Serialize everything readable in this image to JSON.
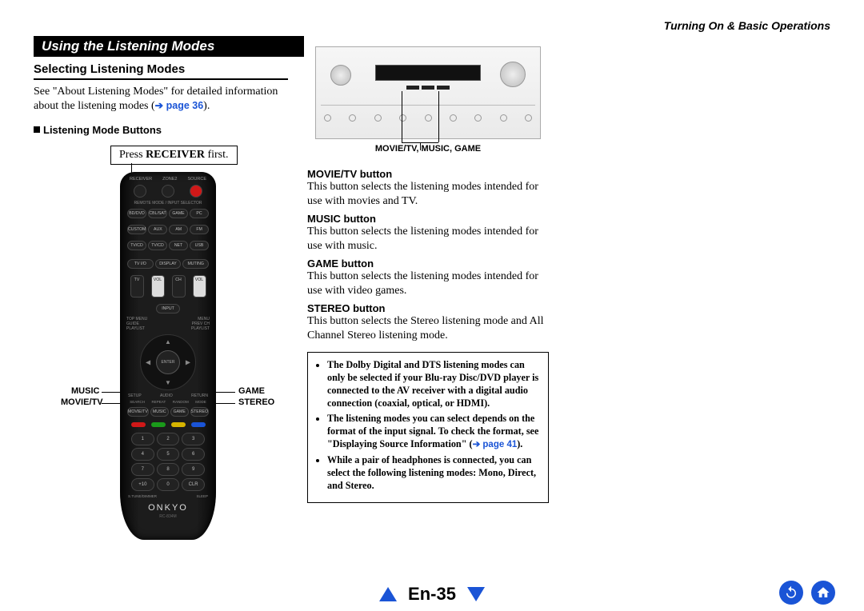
{
  "chapter_title": "Turning On & Basic Operations",
  "section_title": "Using the Listening Modes",
  "subheading": "Selecting Listening Modes",
  "intro_text_1": "See \"About Listening Modes\" for detailed information about the listening modes (",
  "intro_link_arrow": "➔ page 36",
  "intro_text_2": ").",
  "listening_mode_buttons_label": "Listening Mode Buttons",
  "press_receiver_prefix": "Press ",
  "press_receiver_bold": "RECEIVER",
  "press_receiver_suffix": " first.",
  "remote": {
    "brand": "ONKYO",
    "model": "RC-834M",
    "top_labels": [
      "RECEIVER",
      "ZONE2",
      "SOURCE"
    ],
    "selector_label": "REMOTE MODE / INPUT SELECTOR",
    "selector_rows": [
      [
        "BD/DVD",
        "CBL/SAT",
        "GAME",
        "PC"
      ],
      [
        "CUSTOM",
        "AUX",
        "AM",
        "FM"
      ],
      [
        "TV/CD",
        "TV/CD",
        "NET",
        "USB"
      ]
    ],
    "mid_row": [
      "TV I/O",
      "DISPLAY",
      "MUTING"
    ],
    "nav_row": [
      "TV",
      "VOL",
      "CH",
      "VOL"
    ],
    "input_label": "INPUT",
    "side_labels_top": [
      "TOP MENU",
      "",
      "MENU"
    ],
    "side_labels_mid": [
      "GUIDE",
      "",
      "PREV CH"
    ],
    "side_labels_bot": [
      "PLAYLIST",
      "",
      "PLAYLIST"
    ],
    "enter": "ENTER",
    "below_dpad": [
      "SETUP",
      "AUDIO",
      "RETURN"
    ],
    "mode_row_labels": [
      "SEARCH",
      "REPEAT",
      "RANDOM",
      "MODE"
    ],
    "mode_row_btns": [
      "MOVIE/TV",
      "MUSIC",
      "GAME",
      "STEREO"
    ],
    "numpad": [
      "1",
      "2",
      "3",
      "4",
      "5",
      "6",
      "7",
      "8",
      "9",
      "+10",
      "0",
      "CLR"
    ],
    "bottom_row": [
      "S.TUNE/DIMMER",
      "",
      "SLEEP"
    ]
  },
  "callouts_left": {
    "music": "MUSIC",
    "movie_tv": "MOVIE/TV"
  },
  "callouts_right": {
    "game": "GAME",
    "stereo": "STEREO"
  },
  "receiver_callout": "MOVIE/TV, MUSIC, GAME",
  "buttons": {
    "movie_tv": {
      "title": "MOVIE/TV button",
      "text": "This button selects the listening modes intended for use with movies and TV."
    },
    "music": {
      "title": "MUSIC button",
      "text": "This button selects the listening modes intended for use with music."
    },
    "game": {
      "title": "GAME button",
      "text": "This button selects the listening modes intended for use with video games."
    },
    "stereo": {
      "title": "STEREO button",
      "text": "This button selects the Stereo listening mode and All Channel Stereo listening mode."
    }
  },
  "notes": {
    "b1": "The Dolby Digital and DTS listening modes can only be selected if your Blu-ray Disc/DVD player is connected to the AV receiver with a digital audio connection (coaxial, optical, or HDMI).",
    "b2a": "The listening modes you can select depends on the format of the input signal. To check the format, see \"Displaying Source Information\" (",
    "b2link": "➔ page 41",
    "b2b": ").",
    "b3": "While a pair of headphones is connected, you can select the following listening modes: Mono, Direct, and Stereo."
  },
  "page_number": "En-35",
  "colors": {
    "link": "#1a54d6",
    "red": "#d01818",
    "green": "#1a9a1a",
    "yellow": "#d6b400"
  }
}
